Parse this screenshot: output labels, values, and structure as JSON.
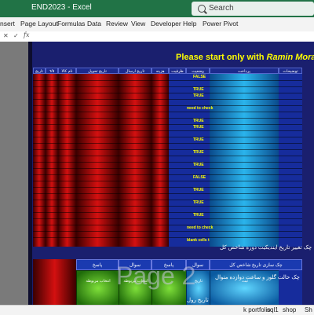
{
  "window": {
    "title": "END2023  -  Excel"
  },
  "search": {
    "placeholder": "Search"
  },
  "ribbon_tabs": [
    "nsert",
    "Page Layout",
    "Formulas",
    "Data",
    "Review",
    "View",
    "Developer",
    "Help",
    "Power Pivot"
  ],
  "formula_bar": {
    "cancel": "✕",
    "enter": "✓",
    "fx": "fx"
  },
  "banner": {
    "prefix": "Please start only with ",
    "name": "Ramin Mora"
  },
  "table_headers": {
    "tarikh": "تاریخ",
    "name_kala": "نام کالا",
    "tarikh_tahvil": "تاریخ تحویل",
    "t_ersal": "تاریخ ارسال",
    "hazine": "هزینه",
    "zarfiat": "ظرفیت",
    "vaziat": "وضعیت",
    "pardakht": "پرداخت",
    "tozihat": "توضیحات"
  },
  "code_date": "٦/٥",
  "statuses": [
    "TRUE",
    "FALSE",
    "need to check",
    "blank cells t"
  ],
  "bottom_headers": [
    "پاسخ",
    "سوال",
    "پاسخ",
    "سوال",
    "چک سازی تاریخ شاخص کل"
  ],
  "buttons": {
    "green1": "انتخاب مربوطه",
    "green2": "انتخاب مربوطه",
    "cyan1": "تاریخ",
    "cyan2": "ثبت"
  },
  "big_labels": {
    "line1": "چک تغییر تاریخ ایندیکیت دوره شاخص کل",
    "line2": "چک حالت گلوز و ساعت دوازده متوال",
    "line3": "تاریخ رول"
  },
  "watermark": "Page 2",
  "sheet_tabs": [
    "k portfolio",
    "sql1",
    "shop",
    "Sh"
  ]
}
